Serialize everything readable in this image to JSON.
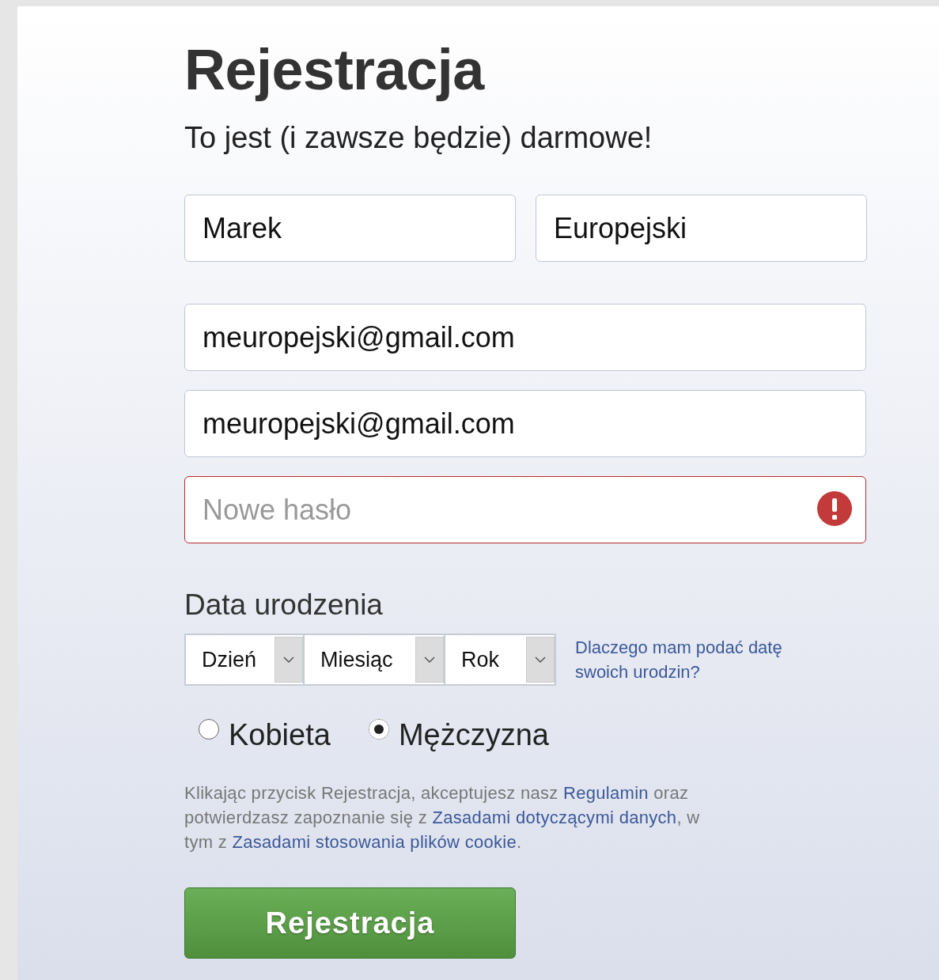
{
  "title": "Rejestracja",
  "subtitle": "To jest (i zawsze będzie) darmowe!",
  "name_fields": [
    {
      "value": "Marek"
    },
    {
      "value": "Europejski"
    }
  ],
  "email_fields": [
    {
      "value": "meuropejski@gmail.com"
    },
    {
      "value": "meuropejski@gmail.com"
    }
  ],
  "password_field": {
    "placeholder": "Nowe hasło",
    "error": true
  },
  "birthday": {
    "label": "Data urodzenia",
    "selects": [
      {
        "label": "Dzień"
      },
      {
        "label": "Miesiąc"
      },
      {
        "label": "Rok"
      }
    ],
    "help_link": "Dlaczego mam podać datę swoich urodzin?"
  },
  "gender": [
    {
      "label": "Kobieta",
      "selected": false
    },
    {
      "label": "Mężczyzna",
      "selected": true
    }
  ],
  "terms": [
    {
      "kind": "text",
      "text": "Klikając przycisk Rejestracja, akceptujesz nasz "
    },
    {
      "kind": "link",
      "text": "Regulamin"
    },
    {
      "kind": "text",
      "text": " oraz potwierdzasz zapoznanie się z "
    },
    {
      "kind": "link",
      "text": "Zasadami dotyczącymi danych"
    },
    {
      "kind": "text",
      "text": ", w tym z "
    },
    {
      "kind": "link",
      "text": "Zasadami stosowania plików cookie"
    },
    {
      "kind": "text",
      "text": "."
    }
  ],
  "submit_button": "Rejestracja"
}
